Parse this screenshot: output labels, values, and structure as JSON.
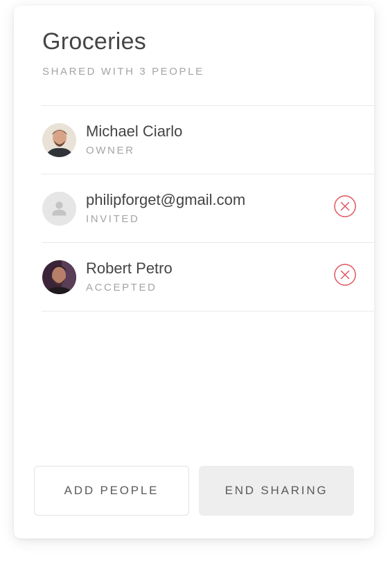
{
  "header": {
    "title": "Groceries",
    "subtitle": "SHARED WITH 3 PEOPLE"
  },
  "people": [
    {
      "name": "Michael Ciarlo",
      "status": "OWNER",
      "avatar": "photo-avatar",
      "removable": false
    },
    {
      "name": "philipforget@gmail.com",
      "status": "INVITED",
      "avatar": "placeholder-person-icon",
      "removable": true
    },
    {
      "name": "Robert Petro",
      "status": "ACCEPTED",
      "avatar": "photo-avatar",
      "removable": true
    }
  ],
  "actions": {
    "add_label": "ADD PEOPLE",
    "end_label": "END SHARING"
  },
  "colors": {
    "remove_icon": "#e0545d",
    "divider": "#e9e9e9",
    "muted_text": "#a4a4a4",
    "end_button_bg": "#eeeeee"
  },
  "icons": {
    "remove": "close-circle-icon"
  }
}
